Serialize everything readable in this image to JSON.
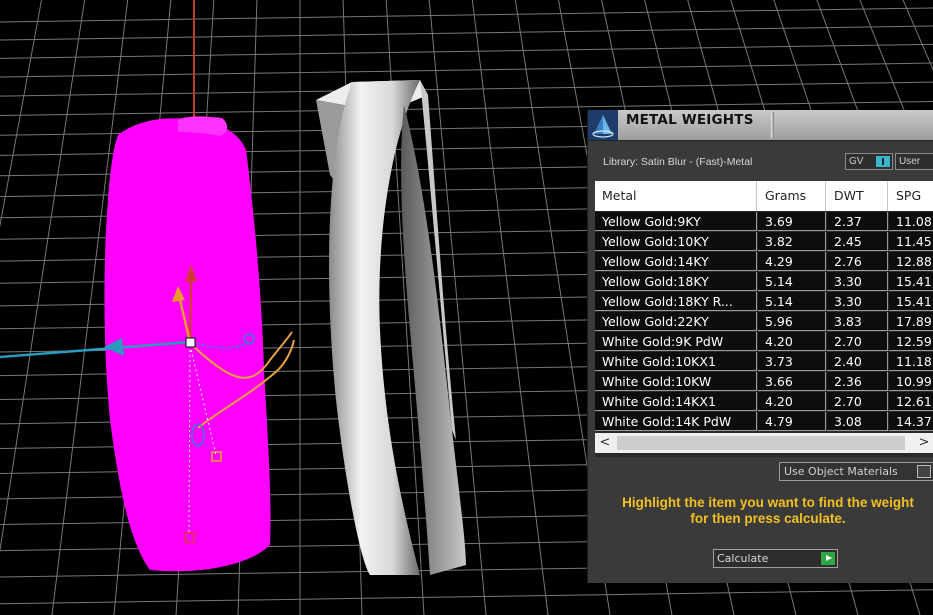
{
  "panel": {
    "title": "METAL WEIGHTS",
    "library_label": "Library: Satin Blur - (Fast)-Metal",
    "gv_toggle_label": "GV",
    "user_toggle_label": "User",
    "table": {
      "columns": [
        "Metal",
        "Grams",
        "DWT",
        "SPG"
      ],
      "rows": [
        [
          "Yellow Gold:9KY",
          "3.69",
          "2.37",
          "11.08"
        ],
        [
          "Yellow Gold:10KY",
          "3.82",
          "2.45",
          "11.45"
        ],
        [
          "Yellow Gold:14KY",
          "4.29",
          "2.76",
          "12.88"
        ],
        [
          "Yellow Gold:18KY",
          "5.14",
          "3.30",
          "15.41"
        ],
        [
          "Yellow Gold:18KY R...",
          "5.14",
          "3.30",
          "15.41"
        ],
        [
          "Yellow Gold:22KY",
          "5.96",
          "3.83",
          "17.89"
        ],
        [
          "White Gold:9K PdW",
          "4.20",
          "2.70",
          "12.59"
        ],
        [
          "White Gold:10KX1",
          "3.73",
          "2.40",
          "11.18"
        ],
        [
          "White Gold:10KW",
          "3.66",
          "2.36",
          "10.99"
        ],
        [
          "White Gold:14KX1",
          "4.20",
          "2.70",
          "12.61"
        ],
        [
          "White Gold:14K PdW",
          "4.79",
          "3.08",
          "14.37"
        ]
      ]
    },
    "scroll_left_glyph": "<",
    "scroll_right_glyph": ">",
    "use_object_materials_label": "Use Object Materials",
    "hint_line1": "Highlight the item you want to find the weight",
    "hint_line2": "for then press calculate.",
    "calculate_label": "Calculate"
  },
  "colors": {
    "selected_object": "#ff00ff",
    "hint_text": "#f2c022",
    "toggle_accent": "#39b6c9",
    "play_button": "#2ea844",
    "grid_line": "#9a9a9a"
  }
}
